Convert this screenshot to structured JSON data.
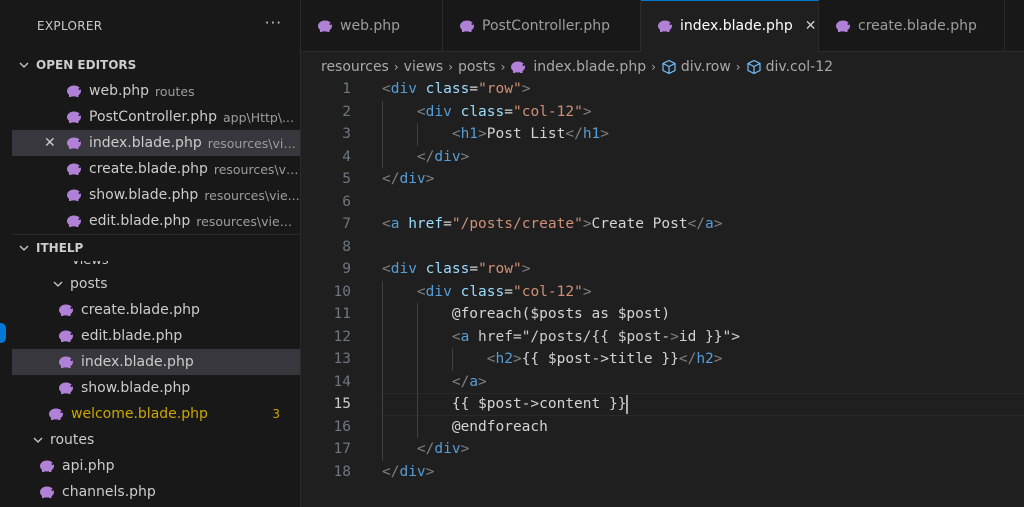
{
  "sidebar": {
    "title": "EXPLORER",
    "more": "···",
    "open_editors": {
      "heading": "OPEN EDITORS",
      "items": [
        {
          "name": "web.php",
          "desc": "routes"
        },
        {
          "name": "PostController.php",
          "desc": "app\\Http\\..."
        },
        {
          "name": "index.blade.php",
          "desc": "resources\\vie..."
        },
        {
          "name": "create.blade.php",
          "desc": "resources\\vie..."
        },
        {
          "name": "show.blade.php",
          "desc": "resources\\vie..."
        },
        {
          "name": "edit.blade.php",
          "desc": "resources\\view..."
        }
      ]
    },
    "project": {
      "heading": "ITHELP",
      "cut_label": "views",
      "posts_folder": "posts",
      "post_files": [
        "create.blade.php",
        "edit.blade.php",
        "index.blade.php",
        "show.blade.php"
      ],
      "welcome": "welcome.blade.php",
      "welcome_badge": "3",
      "routes_folder": "routes",
      "route_files": [
        "api.php",
        "channels.php"
      ]
    }
  },
  "tabs": [
    {
      "label": "web.php"
    },
    {
      "label": "PostController.php"
    },
    {
      "label": "index.blade.php",
      "active": true
    },
    {
      "label": "create.blade.php"
    }
  ],
  "breadcrumb": [
    "resources",
    "views",
    "posts",
    "index.blade.php",
    "div.row",
    "div.col-12"
  ],
  "editor": {
    "lines": [
      "<div class=\"row\">",
      "    <div class=\"col-12\">",
      "        <h1>Post List</h1>",
      "    </div>",
      "</div>",
      "",
      "<a href=\"/posts/create\">Create Post</a>",
      "",
      "<div class=\"row\">",
      "    <div class=\"col-12\">",
      "        @foreach($posts as $post)",
      "        <a href=\"/posts/{{ $post->id }}\">",
      "            <h2>{{ $post->title }}</h2>",
      "        </a>",
      "        {{ $post->content }}",
      "        @endforeach",
      "    </div>",
      "</div>"
    ],
    "current_line": 15
  },
  "colors": {
    "accent": "#0078d4",
    "php_icon": "#b180d7",
    "warning": "#cca700"
  }
}
